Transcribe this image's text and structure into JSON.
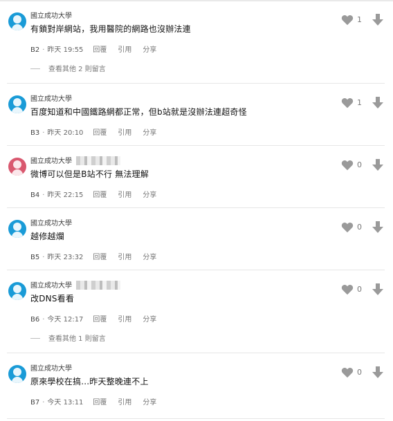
{
  "colors": {
    "accent_avatar_blue": "#1a9bd7",
    "accent_avatar_pink": "#d9586f",
    "icon_grey": "#9a9a9a",
    "separator": "#e6e6e6"
  },
  "actions": {
    "reply": "回覆",
    "quote": "引用",
    "share": "分享"
  },
  "comments": [
    {
      "author": "國立成功大學",
      "avatar": "blue",
      "content": "有鎖對岸網站，我用醫院的網路也沒辦法連",
      "floor": "B2",
      "time": "昨天 19:55",
      "likes": "1",
      "more": "查看其他 2 則留言"
    },
    {
      "author": "國立成功大學",
      "avatar": "blue",
      "content": "百度知道和中國鐵路網都正常，但b站就是沒辦法連超奇怪",
      "floor": "B3",
      "time": "昨天 20:10",
      "likes": "1"
    },
    {
      "author": "國立成功大學",
      "avatar": "pink",
      "content": "微博可以但是B站不行 無法理解",
      "floor": "B4",
      "time": "昨天 22:15",
      "likes": "0"
    },
    {
      "author": "國立成功大學",
      "avatar": "blue",
      "content": "越修越爛",
      "floor": "B5",
      "time": "昨天 23:32",
      "likes": "0"
    },
    {
      "author": "國立成功大學",
      "avatar": "blue",
      "content": "改DNS看看",
      "floor": "B6",
      "time": "今天 12:17",
      "likes": "0",
      "more": "查看其他 1 則留言"
    },
    {
      "author": "國立成功大學",
      "avatar": "blue",
      "content": "原來學校在搞...昨天整晚連不上",
      "floor": "B7",
      "time": "今天 13:11",
      "likes": "0"
    }
  ]
}
